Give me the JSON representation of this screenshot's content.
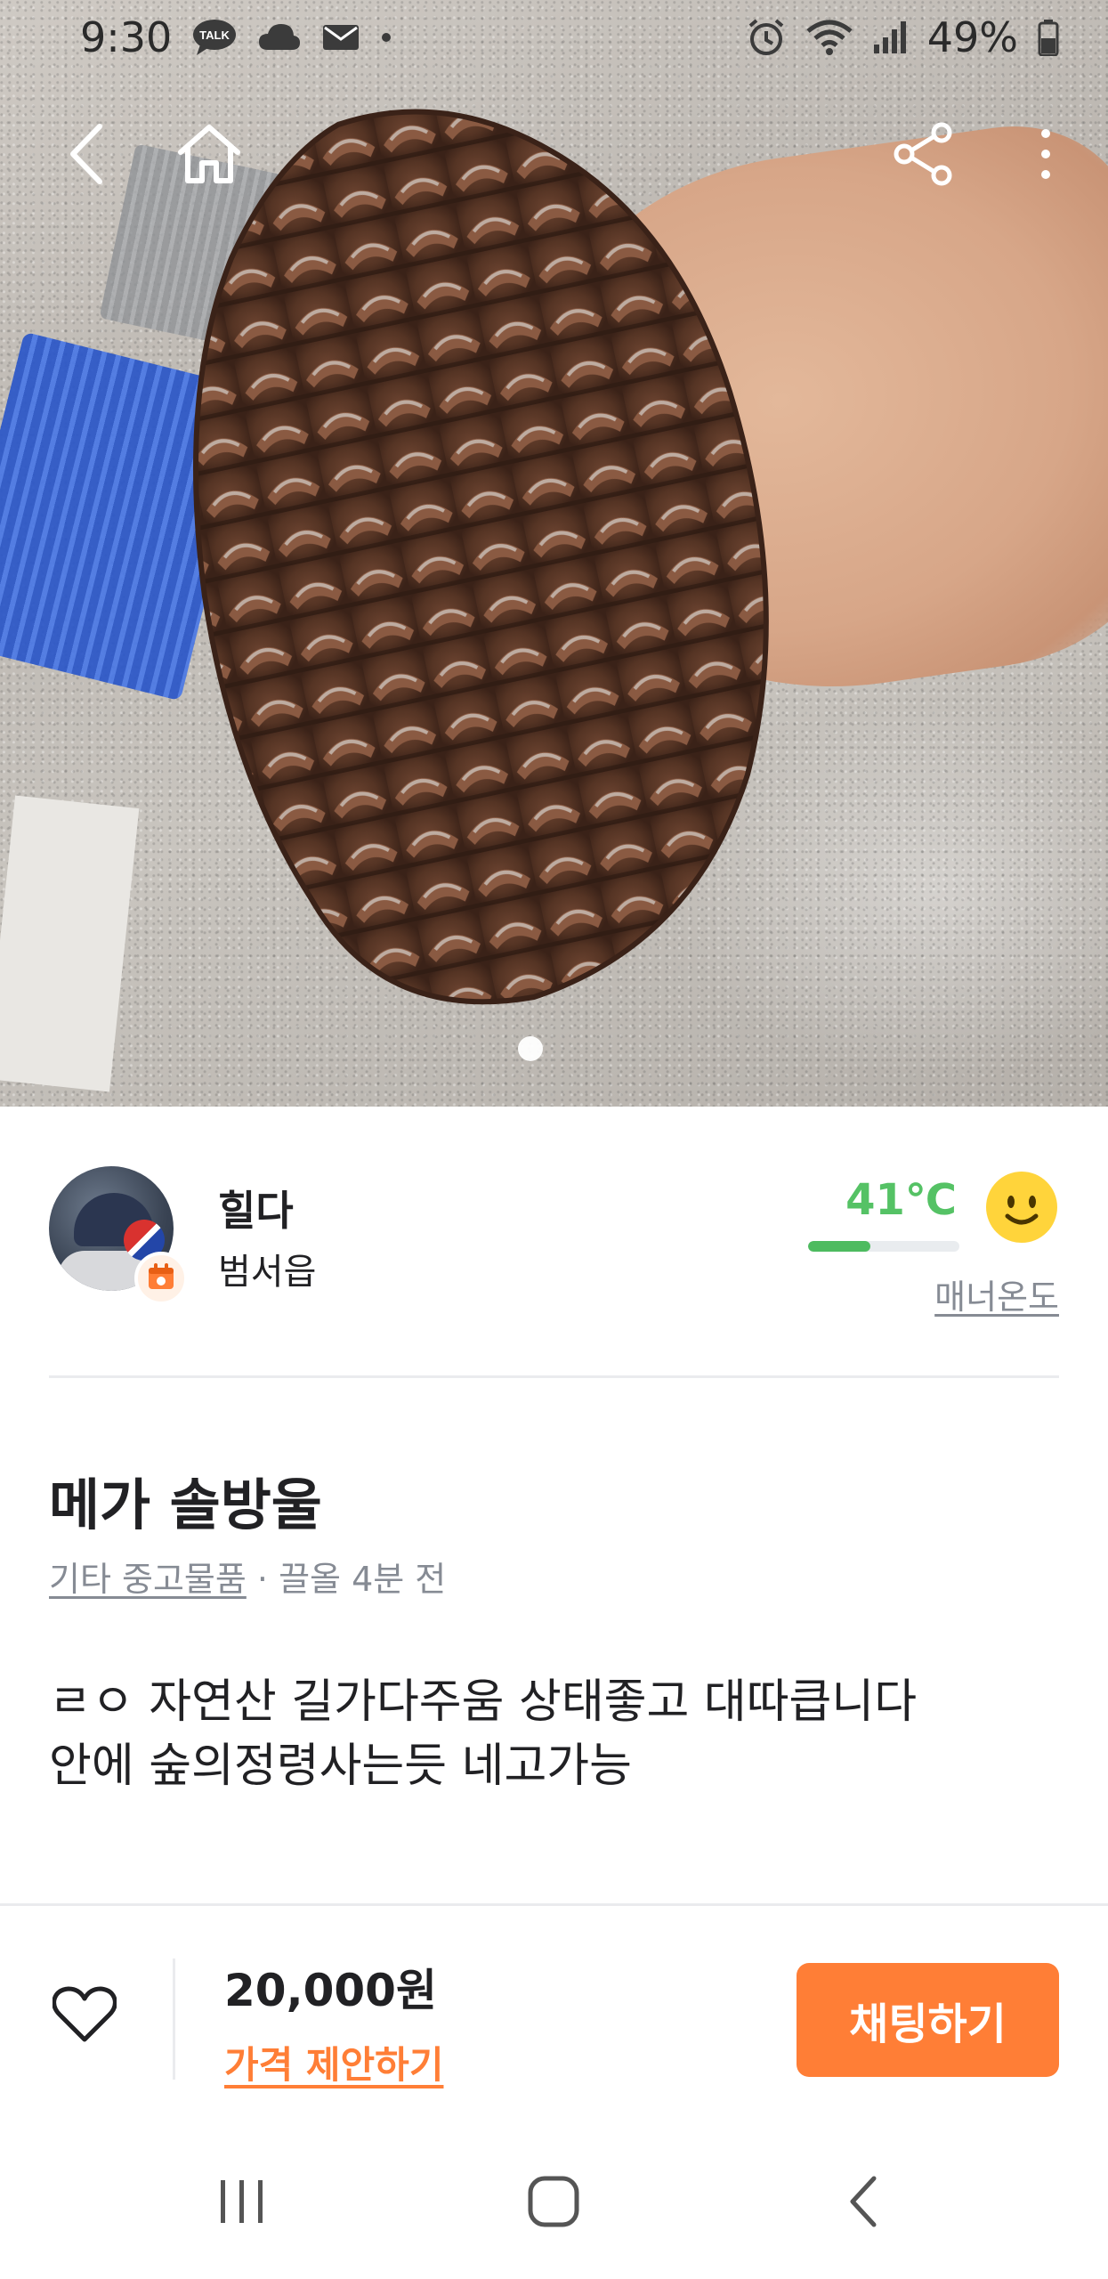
{
  "status_bar": {
    "time": "9:30",
    "battery": "49%",
    "left_icons": [
      "talk-icon",
      "cloud-icon",
      "mail-icon",
      "dot-icon"
    ],
    "right_icons": [
      "alarm-icon",
      "wifi-icon",
      "signal-icon",
      "battery-icon"
    ]
  },
  "top_nav": {
    "icons": [
      "back-arrow-icon",
      "home-icon",
      "share-icon",
      "more-vertical-icon"
    ]
  },
  "photo": {
    "page_count": 1,
    "current_page": 1
  },
  "seller": {
    "name": "힐다",
    "location": "범서읍",
    "badge_icon": "calendar-icon",
    "manner_temp": "41℃",
    "manner_temp_value": 41,
    "manner_label": "매너온도",
    "manner_face_icon": "smile-face-icon",
    "colors": {
      "temp_green": "#55c265"
    }
  },
  "post": {
    "title": "메가 솔방울",
    "category": "기타 중고물품",
    "meta_sep": " · ",
    "time_ago": "끌올 4분 전",
    "body_line1": "ㄹㅇ 자연산 길가다주움 상태좋고 대따큽니다",
    "body_line2": "안에 숲의정령사는듯 네고가능"
  },
  "action_bar": {
    "price": "20,000원",
    "offer_label": "가격 제안하기",
    "chat_label": "채팅하기",
    "like_icon": "heart-icon",
    "colors": {
      "accent": "#ff7e36"
    }
  },
  "system_nav": {
    "icons": [
      "recent-apps-icon",
      "home-square-icon",
      "back-chevron-icon"
    ]
  }
}
